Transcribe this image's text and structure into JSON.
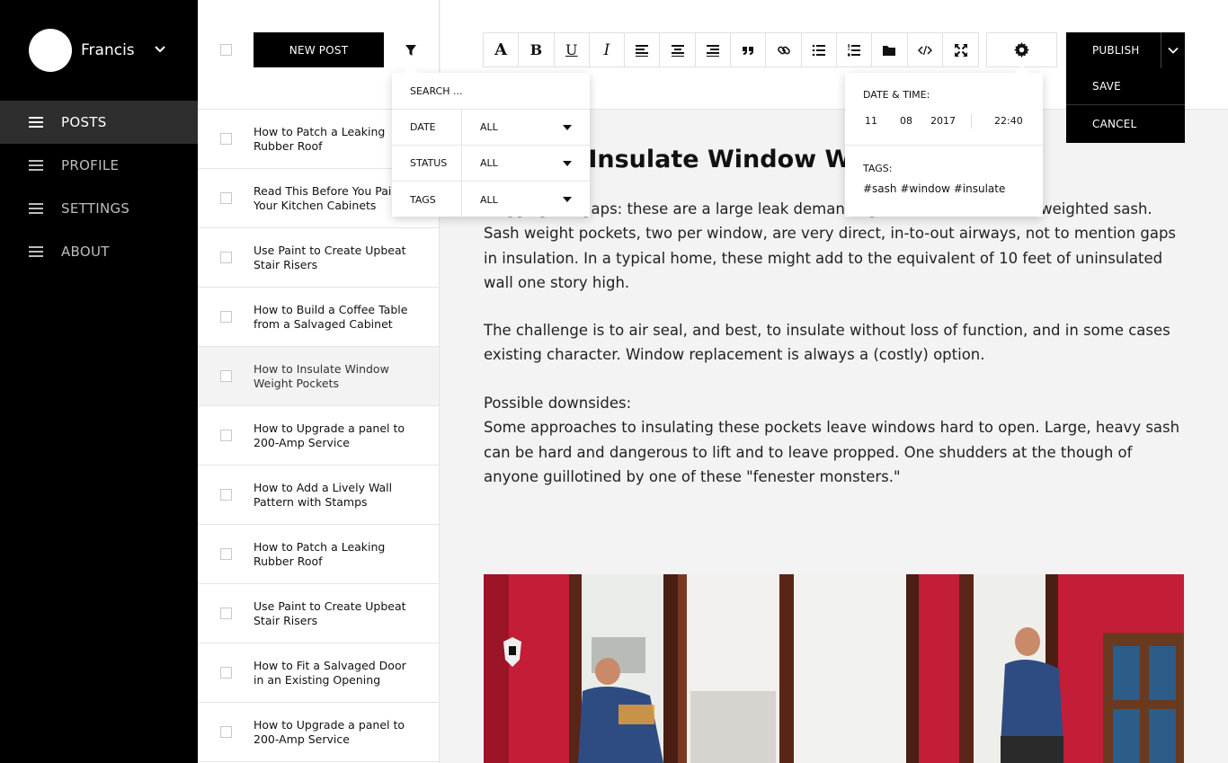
{
  "user": {
    "name": "Francis"
  },
  "nav": [
    {
      "label": "POSTS",
      "active": true
    },
    {
      "label": "PROFILE",
      "active": false
    },
    {
      "label": "SETTINGS",
      "active": false
    },
    {
      "label": "ABOUT",
      "active": false
    }
  ],
  "list": {
    "new_post_label": "NEW POST",
    "posts": [
      {
        "title": "How to Patch a Leaking Rubber Roof"
      },
      {
        "title": "Read This Before You Paint Your Kitchen Cabinets"
      },
      {
        "title": "Use Paint to Create Upbeat Stair Risers"
      },
      {
        "title": "How to Build a Coffee Table from a Salvaged Cabinet"
      },
      {
        "title": "How to Insulate Window Weight Pockets"
      },
      {
        "title": "How to Upgrade a panel to 200-Amp Service"
      },
      {
        "title": "How to Add a Lively Wall Pattern with Stamps"
      },
      {
        "title": "How to Patch a Leaking Rubber Roof"
      },
      {
        "title": "Use Paint to Create Upbeat Stair Risers"
      },
      {
        "title": "How to Fit a Salvaged Door in an Existing Opening"
      },
      {
        "title": "How to Upgrade a panel to 200-Amp Service"
      }
    ],
    "selected_index": 4
  },
  "toolbar": {
    "buttons": [
      "font-icon",
      "bold-icon",
      "underline-icon",
      "italic-icon",
      "align-left-icon",
      "align-center-icon",
      "align-right-icon",
      "quote-icon",
      "link-icon",
      "bulleted-list-icon",
      "numbered-list-icon",
      "folder-icon",
      "code-icon",
      "fullscreen-icon"
    ]
  },
  "publish": {
    "publish_label": "PUBLISH",
    "save_label": "SAVE",
    "cancel_label": "CANCEL"
  },
  "filter": {
    "search_placeholder": "SEARCH ...",
    "rows": [
      {
        "label": "DATE",
        "value": "ALL"
      },
      {
        "label": "STATUS",
        "value": "ALL"
      },
      {
        "label": "TAGS",
        "value": "ALL"
      }
    ]
  },
  "settings": {
    "datetime_label": "DATE & TIME:",
    "day": "11",
    "month": "08",
    "year": "2017",
    "time": "22:40",
    "tags_label": "TAGS:",
    "tags": "#sash #window #insulate"
  },
  "article": {
    "title": "How to Insulate Window Weight Pockets",
    "p1": "Plugging the gaps: these are a large leak demanding attention around the weighted sash. Sash weight pockets, two per window, are very direct, in-to-out airways, not to mention gaps in insulation. In a typical home, these might add to the equivalent of 10 feet of uninsulated wall one story high.",
    "p2": "The challenge is to air seal, and best, to insulate without loss of function, and in some cases existing character. Window replacement is always a (costly) option.",
    "p3_heading": "Possible downsides:",
    "p3": "Some approaches to insulating these pockets leave windows hard to open. Large, heavy sash can be hard and dangerous to lift and to leave propped. One shudders at the though of anyone guillotined by one of these \"fenester monsters.\""
  },
  "colors": {
    "sidebar": "#000000",
    "active_nav": "#2e2e2e",
    "accent": "#000000",
    "photo_wall": "#c91c3a"
  }
}
